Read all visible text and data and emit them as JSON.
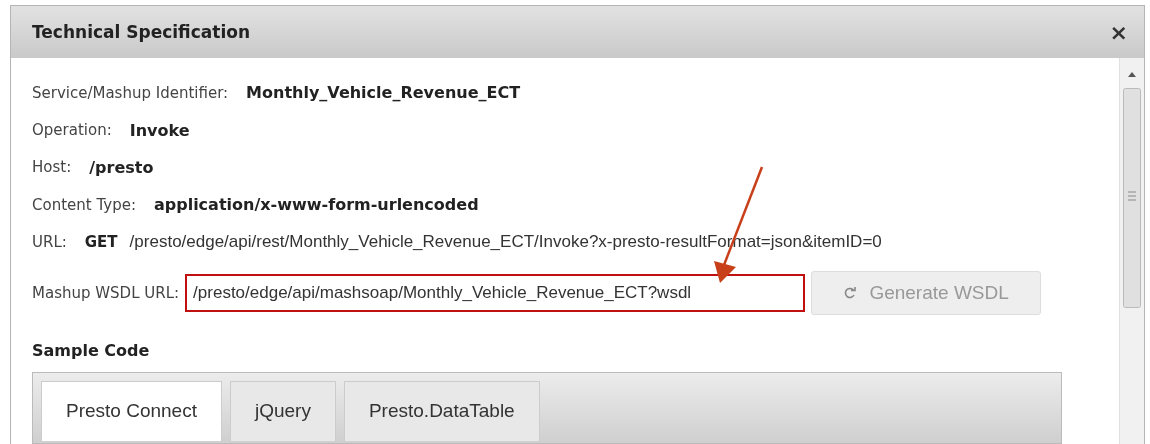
{
  "dialog": {
    "title": "Technical Specification",
    "close": "×"
  },
  "properties": [
    {
      "kind": "text",
      "label": "Service/Mashup Identifier:",
      "value": "Monthly_Vehicle_Revenue_ECT"
    },
    {
      "kind": "text",
      "label": "Operation:",
      "value": "Invoke"
    },
    {
      "kind": "text",
      "label": "Host:",
      "value": "/presto"
    },
    {
      "kind": "text",
      "label": "Content Type:",
      "value": "application/x-www-form-urlencoded"
    },
    {
      "kind": "url",
      "label": "URL:",
      "method": "GET",
      "value": "/presto/edge/api/rest/Monthly_Vehicle_Revenue_ECT/Invoke?x-presto-resultFormat=json&itemID=0"
    }
  ],
  "wsdl": {
    "label": "Mashup WSDL URL:",
    "value": "/presto/edge/api/mashsoap/Monthly_Vehicle_Revenue_ECT?wsdl",
    "highlighted": true,
    "button": {
      "label": "Generate WSDL",
      "disabled": true
    }
  },
  "sample_code": {
    "title": "Sample Code",
    "tabs": [
      {
        "label": "Presto Connect",
        "selected": true
      },
      {
        "label": "jQuery",
        "selected": false
      },
      {
        "label": "Presto.DataTable",
        "selected": false
      }
    ]
  }
}
